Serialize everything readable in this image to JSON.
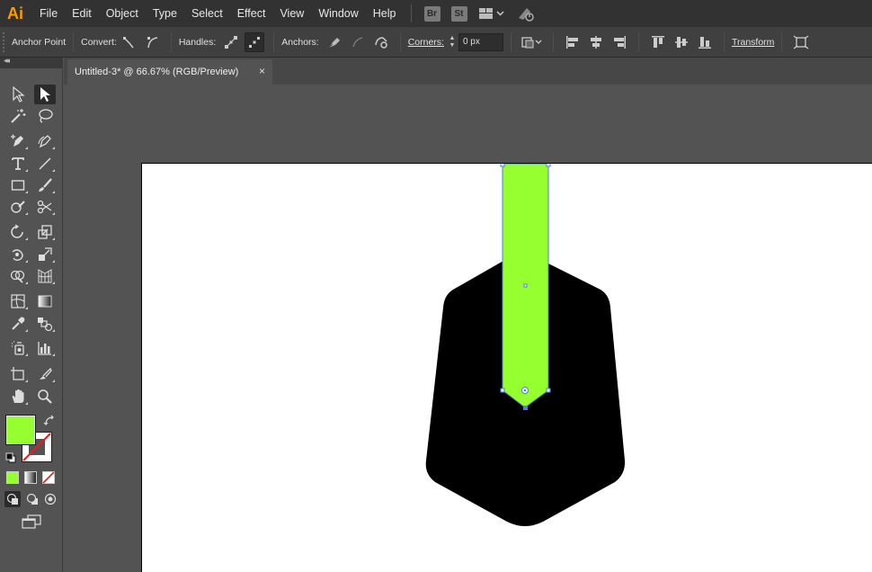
{
  "app": {
    "logo": "Ai"
  },
  "menubar": {
    "items": [
      "File",
      "Edit",
      "Object",
      "Type",
      "Select",
      "Effect",
      "View",
      "Window",
      "Help"
    ],
    "bridge_label": "Br",
    "stock_label": "St",
    "arrange_icon": "arrange-documents-icon",
    "sync_icon": "sync-settings-icon"
  },
  "controlbar": {
    "title": "Anchor Point",
    "convert_label": "Convert:",
    "handles_label": "Handles:",
    "anchors_label": "Anchors:",
    "corners_label": "Corners:",
    "corners_value": "0 px",
    "transform_label": "Transform"
  },
  "tools": {
    "collapse_glyph": "◂◂",
    "fill_color": "#95ff2f",
    "stroke": "none"
  },
  "document": {
    "tab_title": "Untitled-3* @ 66.67% (RGB/Preview)",
    "close_glyph": "×"
  },
  "artwork": {
    "shape_color": "#000000",
    "selected_color": "#95ff2f",
    "selection_color": "#4a7fe0"
  }
}
